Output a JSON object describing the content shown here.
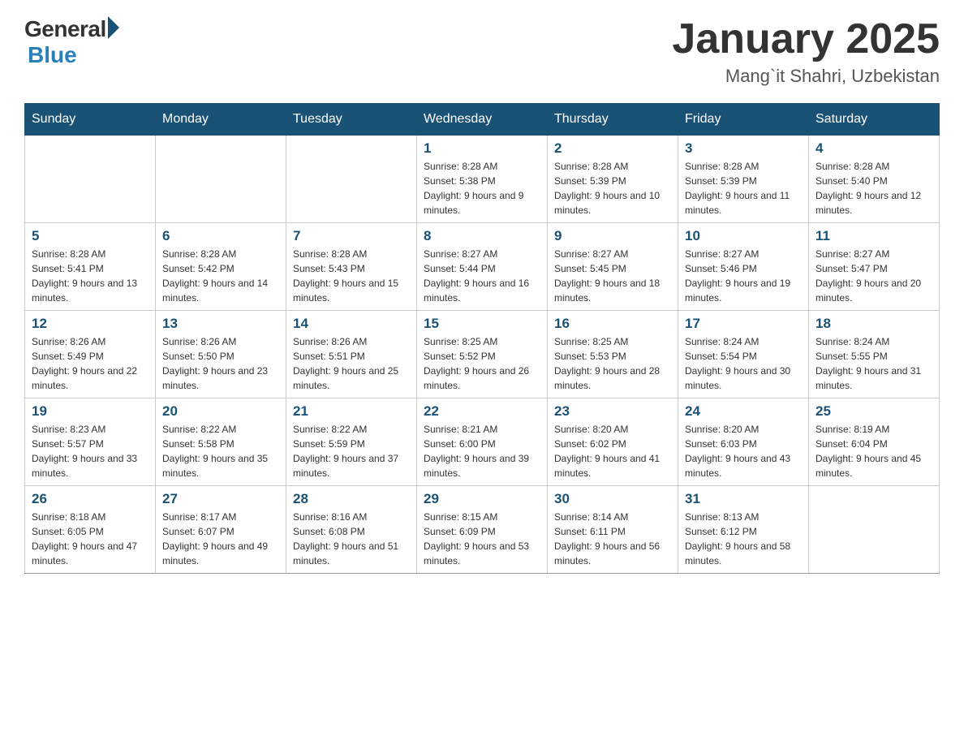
{
  "header": {
    "logo_general": "General",
    "logo_blue": "Blue",
    "month_title": "January 2025",
    "subtitle": "Mang`it Shahri, Uzbekistan"
  },
  "days_of_week": [
    "Sunday",
    "Monday",
    "Tuesday",
    "Wednesday",
    "Thursday",
    "Friday",
    "Saturday"
  ],
  "weeks": [
    [
      {
        "num": "",
        "info": ""
      },
      {
        "num": "",
        "info": ""
      },
      {
        "num": "",
        "info": ""
      },
      {
        "num": "1",
        "info": "Sunrise: 8:28 AM\nSunset: 5:38 PM\nDaylight: 9 hours and 9 minutes."
      },
      {
        "num": "2",
        "info": "Sunrise: 8:28 AM\nSunset: 5:39 PM\nDaylight: 9 hours and 10 minutes."
      },
      {
        "num": "3",
        "info": "Sunrise: 8:28 AM\nSunset: 5:39 PM\nDaylight: 9 hours and 11 minutes."
      },
      {
        "num": "4",
        "info": "Sunrise: 8:28 AM\nSunset: 5:40 PM\nDaylight: 9 hours and 12 minutes."
      }
    ],
    [
      {
        "num": "5",
        "info": "Sunrise: 8:28 AM\nSunset: 5:41 PM\nDaylight: 9 hours and 13 minutes."
      },
      {
        "num": "6",
        "info": "Sunrise: 8:28 AM\nSunset: 5:42 PM\nDaylight: 9 hours and 14 minutes."
      },
      {
        "num": "7",
        "info": "Sunrise: 8:28 AM\nSunset: 5:43 PM\nDaylight: 9 hours and 15 minutes."
      },
      {
        "num": "8",
        "info": "Sunrise: 8:27 AM\nSunset: 5:44 PM\nDaylight: 9 hours and 16 minutes."
      },
      {
        "num": "9",
        "info": "Sunrise: 8:27 AM\nSunset: 5:45 PM\nDaylight: 9 hours and 18 minutes."
      },
      {
        "num": "10",
        "info": "Sunrise: 8:27 AM\nSunset: 5:46 PM\nDaylight: 9 hours and 19 minutes."
      },
      {
        "num": "11",
        "info": "Sunrise: 8:27 AM\nSunset: 5:47 PM\nDaylight: 9 hours and 20 minutes."
      }
    ],
    [
      {
        "num": "12",
        "info": "Sunrise: 8:26 AM\nSunset: 5:49 PM\nDaylight: 9 hours and 22 minutes."
      },
      {
        "num": "13",
        "info": "Sunrise: 8:26 AM\nSunset: 5:50 PM\nDaylight: 9 hours and 23 minutes."
      },
      {
        "num": "14",
        "info": "Sunrise: 8:26 AM\nSunset: 5:51 PM\nDaylight: 9 hours and 25 minutes."
      },
      {
        "num": "15",
        "info": "Sunrise: 8:25 AM\nSunset: 5:52 PM\nDaylight: 9 hours and 26 minutes."
      },
      {
        "num": "16",
        "info": "Sunrise: 8:25 AM\nSunset: 5:53 PM\nDaylight: 9 hours and 28 minutes."
      },
      {
        "num": "17",
        "info": "Sunrise: 8:24 AM\nSunset: 5:54 PM\nDaylight: 9 hours and 30 minutes."
      },
      {
        "num": "18",
        "info": "Sunrise: 8:24 AM\nSunset: 5:55 PM\nDaylight: 9 hours and 31 minutes."
      }
    ],
    [
      {
        "num": "19",
        "info": "Sunrise: 8:23 AM\nSunset: 5:57 PM\nDaylight: 9 hours and 33 minutes."
      },
      {
        "num": "20",
        "info": "Sunrise: 8:22 AM\nSunset: 5:58 PM\nDaylight: 9 hours and 35 minutes."
      },
      {
        "num": "21",
        "info": "Sunrise: 8:22 AM\nSunset: 5:59 PM\nDaylight: 9 hours and 37 minutes."
      },
      {
        "num": "22",
        "info": "Sunrise: 8:21 AM\nSunset: 6:00 PM\nDaylight: 9 hours and 39 minutes."
      },
      {
        "num": "23",
        "info": "Sunrise: 8:20 AM\nSunset: 6:02 PM\nDaylight: 9 hours and 41 minutes."
      },
      {
        "num": "24",
        "info": "Sunrise: 8:20 AM\nSunset: 6:03 PM\nDaylight: 9 hours and 43 minutes."
      },
      {
        "num": "25",
        "info": "Sunrise: 8:19 AM\nSunset: 6:04 PM\nDaylight: 9 hours and 45 minutes."
      }
    ],
    [
      {
        "num": "26",
        "info": "Sunrise: 8:18 AM\nSunset: 6:05 PM\nDaylight: 9 hours and 47 minutes."
      },
      {
        "num": "27",
        "info": "Sunrise: 8:17 AM\nSunset: 6:07 PM\nDaylight: 9 hours and 49 minutes."
      },
      {
        "num": "28",
        "info": "Sunrise: 8:16 AM\nSunset: 6:08 PM\nDaylight: 9 hours and 51 minutes."
      },
      {
        "num": "29",
        "info": "Sunrise: 8:15 AM\nSunset: 6:09 PM\nDaylight: 9 hours and 53 minutes."
      },
      {
        "num": "30",
        "info": "Sunrise: 8:14 AM\nSunset: 6:11 PM\nDaylight: 9 hours and 56 minutes."
      },
      {
        "num": "31",
        "info": "Sunrise: 8:13 AM\nSunset: 6:12 PM\nDaylight: 9 hours and 58 minutes."
      },
      {
        "num": "",
        "info": ""
      }
    ]
  ]
}
